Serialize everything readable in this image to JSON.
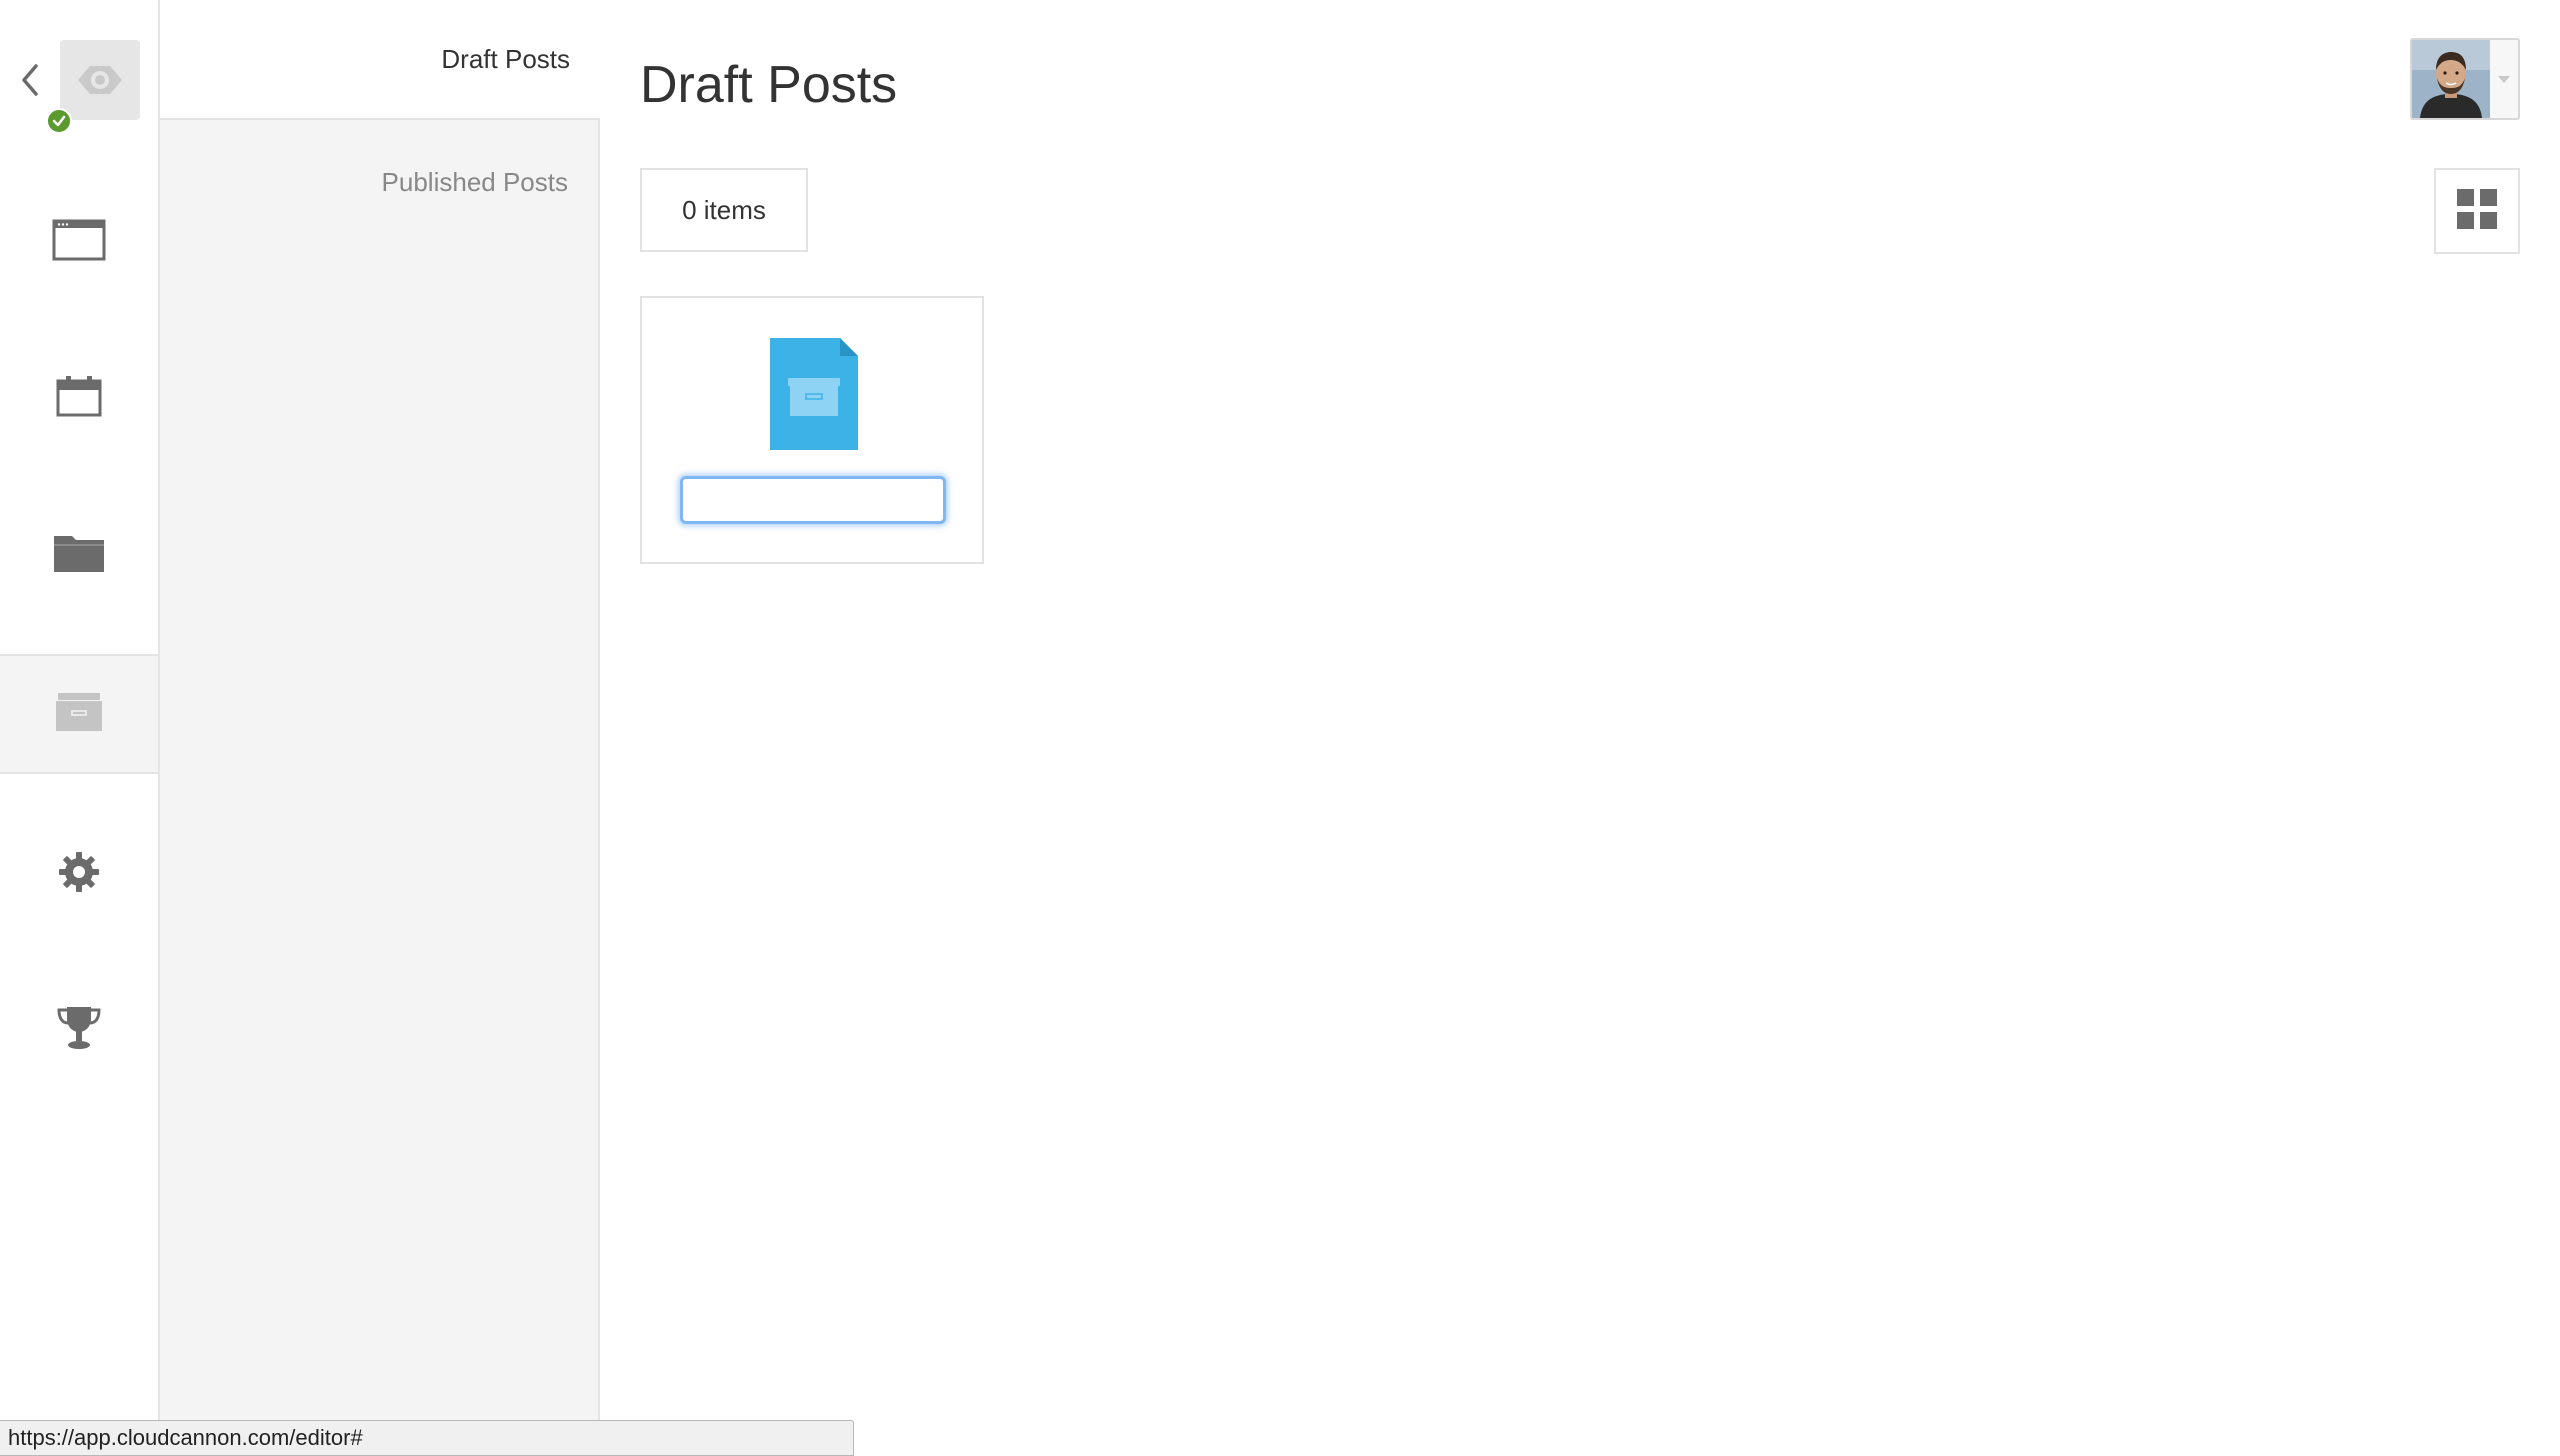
{
  "colors": {
    "accent": "#3daee9",
    "status_ok": "#5a9a2e",
    "icon_gray": "#6b6b6b",
    "rail_bg": "#ffffff",
    "subnav_bg": "#f4f4f4",
    "focus_ring": "#7fb8f0"
  },
  "rail": {
    "back_icon": "chevron-left-icon",
    "logo_icon": "cloudcannon-logo-icon",
    "status_icon": "check-circle-icon",
    "items": [
      {
        "id": "pages",
        "icon": "browser-window-icon"
      },
      {
        "id": "posts",
        "icon": "calendar-icon"
      },
      {
        "id": "files",
        "icon": "folder-icon"
      },
      {
        "id": "drafts",
        "icon": "archive-box-icon",
        "active": true
      },
      {
        "id": "settings",
        "icon": "gear-icon"
      },
      {
        "id": "achievements",
        "icon": "trophy-icon"
      }
    ]
  },
  "subnav": {
    "items": [
      {
        "label": "Draft Posts",
        "active": true
      },
      {
        "label": "Published Posts",
        "active": false
      }
    ]
  },
  "main": {
    "title": "Draft Posts",
    "items_count": "0 items",
    "view_toggle_icon": "grid-view-icon",
    "new_file": {
      "icon": "archive-file-icon",
      "name_value": ""
    }
  },
  "header": {
    "avatar_icon": "user-avatar",
    "caret_icon": "caret-down-icon"
  },
  "status_bar": {
    "url": "https://app.cloudcannon.com/editor#"
  }
}
